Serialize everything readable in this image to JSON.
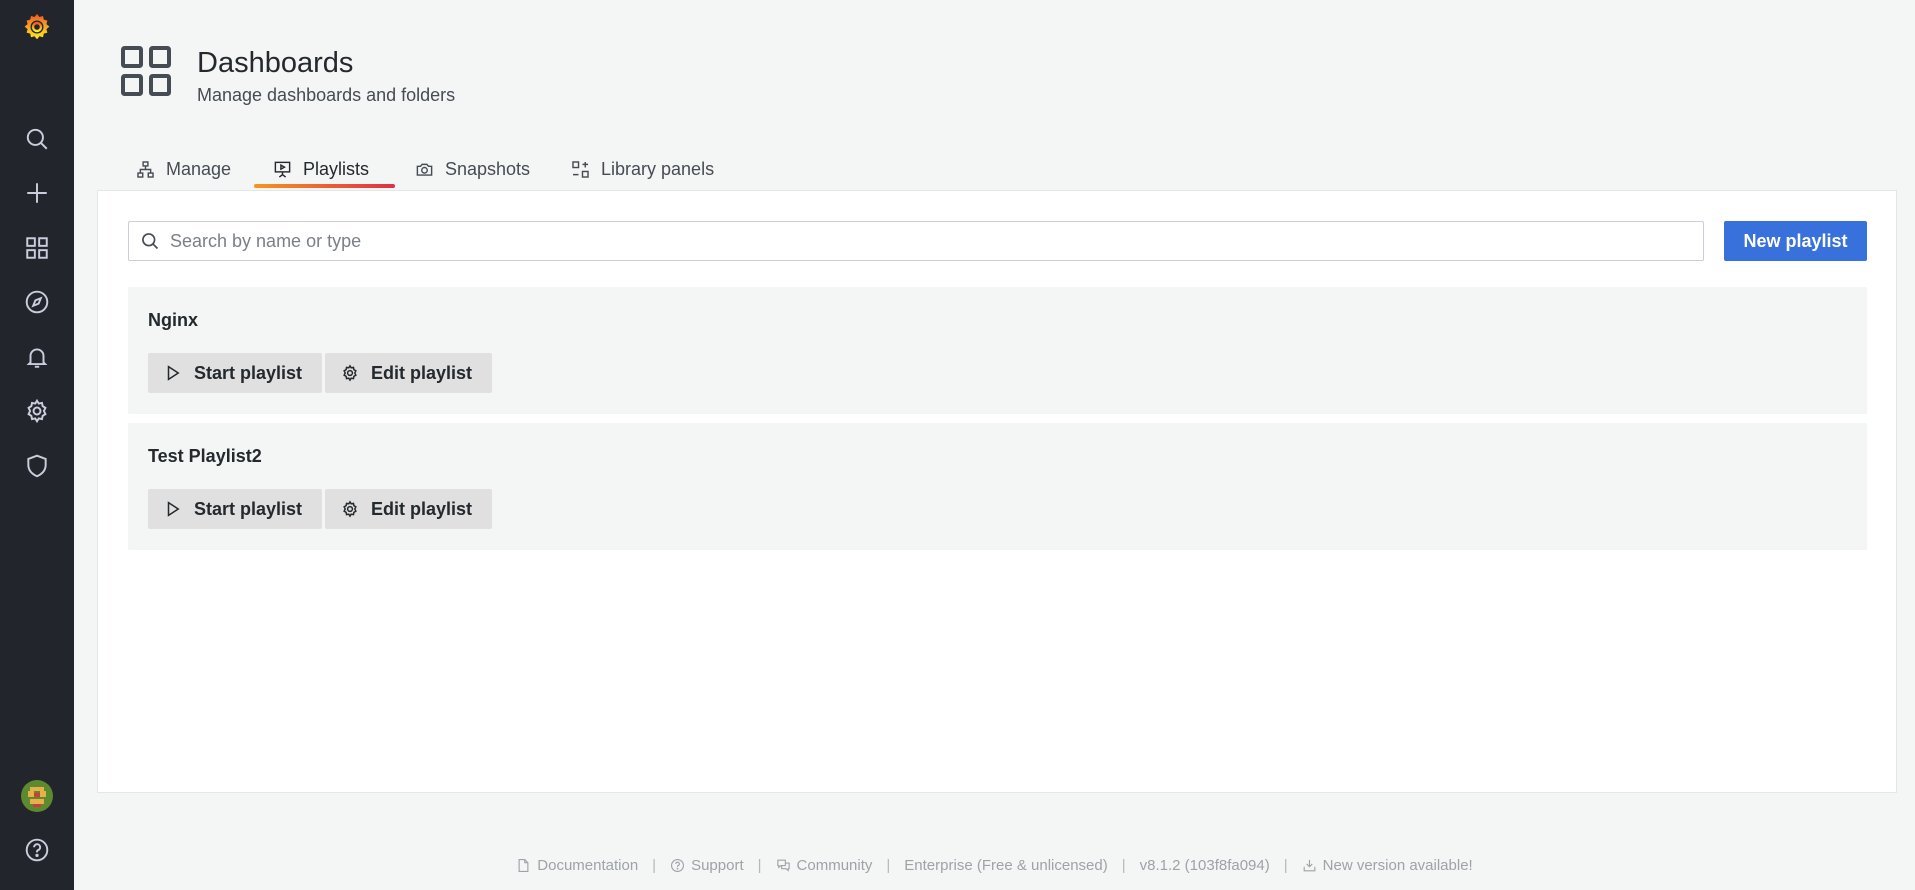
{
  "colors": {
    "sidebar_bg": "#22252b",
    "page_bg": "#f4f5f5",
    "primary": "#3871dc",
    "tab_underline_from": "#f79520",
    "tab_underline_to": "#e02f44"
  },
  "sidebar": {
    "logo_icon": "grafana-logo-icon",
    "items": [
      {
        "icon": "search-icon"
      },
      {
        "icon": "plus-icon"
      },
      {
        "icon": "dashboards-grid-icon"
      },
      {
        "icon": "explore-compass-icon"
      },
      {
        "icon": "alerting-bell-icon"
      },
      {
        "icon": "configuration-gear-icon"
      },
      {
        "icon": "server-admin-shield-icon"
      }
    ],
    "bottom": [
      {
        "icon": "user-avatar"
      },
      {
        "icon": "help-question-icon"
      }
    ]
  },
  "header": {
    "title": "Dashboards",
    "subtitle": "Manage dashboards and folders"
  },
  "tabs": [
    {
      "label": "Manage",
      "icon": "sitemap-icon",
      "active": false
    },
    {
      "label": "Playlists",
      "icon": "presentation-play-icon",
      "active": true
    },
    {
      "label": "Snapshots",
      "icon": "camera-icon",
      "active": false
    },
    {
      "label": "Library panels",
      "icon": "library-panel-icon",
      "active": false
    }
  ],
  "search": {
    "placeholder": "Search by name or type",
    "value": ""
  },
  "new_playlist_label": "New playlist",
  "playlists": [
    {
      "name": "Nginx",
      "start_label": "Start playlist",
      "edit_label": "Edit playlist"
    },
    {
      "name": "Test Playlist2",
      "start_label": "Start playlist",
      "edit_label": "Edit playlist"
    }
  ],
  "footer": {
    "documentation": "Documentation",
    "support": "Support",
    "community": "Community",
    "edition": "Enterprise (Free & unlicensed)",
    "version": "v8.1.2 (103f8fa094)",
    "update": "New version available!"
  }
}
